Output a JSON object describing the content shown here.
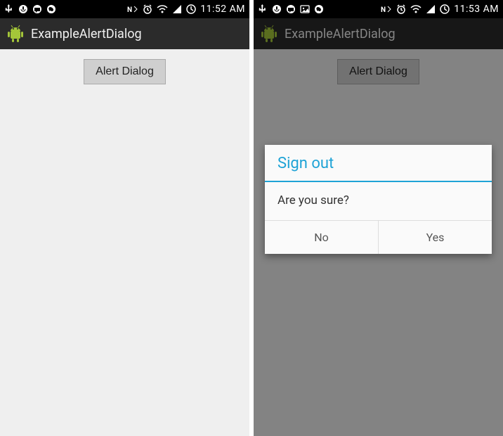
{
  "left": {
    "statusbar": {
      "time": "11:52 AM",
      "icons_left": [
        "usb-icon",
        "voice-icon",
        "chat-icon",
        "whatsapp-icon"
      ],
      "icons_right": [
        "nfc-icon",
        "alarm-icon",
        "wifi-icon",
        "signal-icon",
        "battery-icon"
      ]
    },
    "appbar": {
      "title": "ExampleAlertDialog"
    },
    "content": {
      "button_label": "Alert Dialog"
    }
  },
  "right": {
    "statusbar": {
      "time": "11:53 AM",
      "icons_left": [
        "usb-icon",
        "voice-icon",
        "chat-icon",
        "image-icon",
        "whatsapp-icon"
      ],
      "icons_right": [
        "nfc-icon",
        "alarm-icon",
        "wifi-icon",
        "signal-icon",
        "battery-icon"
      ]
    },
    "appbar": {
      "title": "ExampleAlertDialog"
    },
    "content": {
      "button_label": "Alert Dialog"
    },
    "dialog": {
      "title": "Sign out",
      "message": "Are you sure?",
      "no_label": "No",
      "yes_label": "Yes"
    }
  },
  "colors": {
    "accent": "#1fa3d6"
  }
}
